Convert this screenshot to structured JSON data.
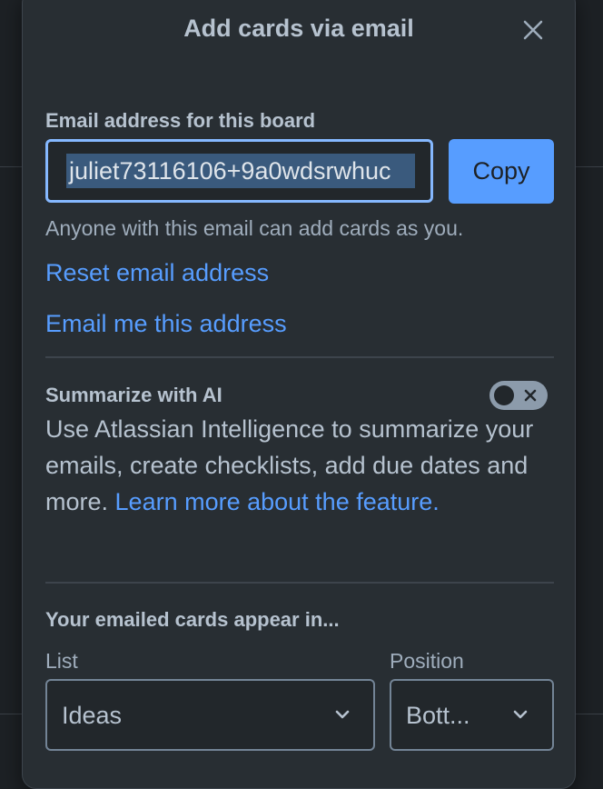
{
  "dialog": {
    "title": "Add cards via email",
    "close_icon": "close-icon"
  },
  "email": {
    "label": "Email address for this board",
    "value": "juliet73116106+9a0wdsrwhuc",
    "copy_label": "Copy",
    "helper": "Anyone with this email can add cards as you.",
    "reset_link": "Reset email address",
    "email_me_link": "Email me this address"
  },
  "ai": {
    "label": "Summarize with AI",
    "toggle_on": false,
    "toggle_icon": "x-icon",
    "description": "Use Atlassian Intelligence to summarize your emails, create checklists, add due dates and more. ",
    "learn_more": "Learn more about the feature."
  },
  "placement": {
    "heading": "Your emailed cards appear in...",
    "list_label": "List",
    "list_value": "Ideas",
    "position_label": "Position",
    "position_value": "Bott..."
  },
  "colors": {
    "background": "#282e33",
    "accent": "#579dff",
    "focus": "#85b8ff"
  }
}
